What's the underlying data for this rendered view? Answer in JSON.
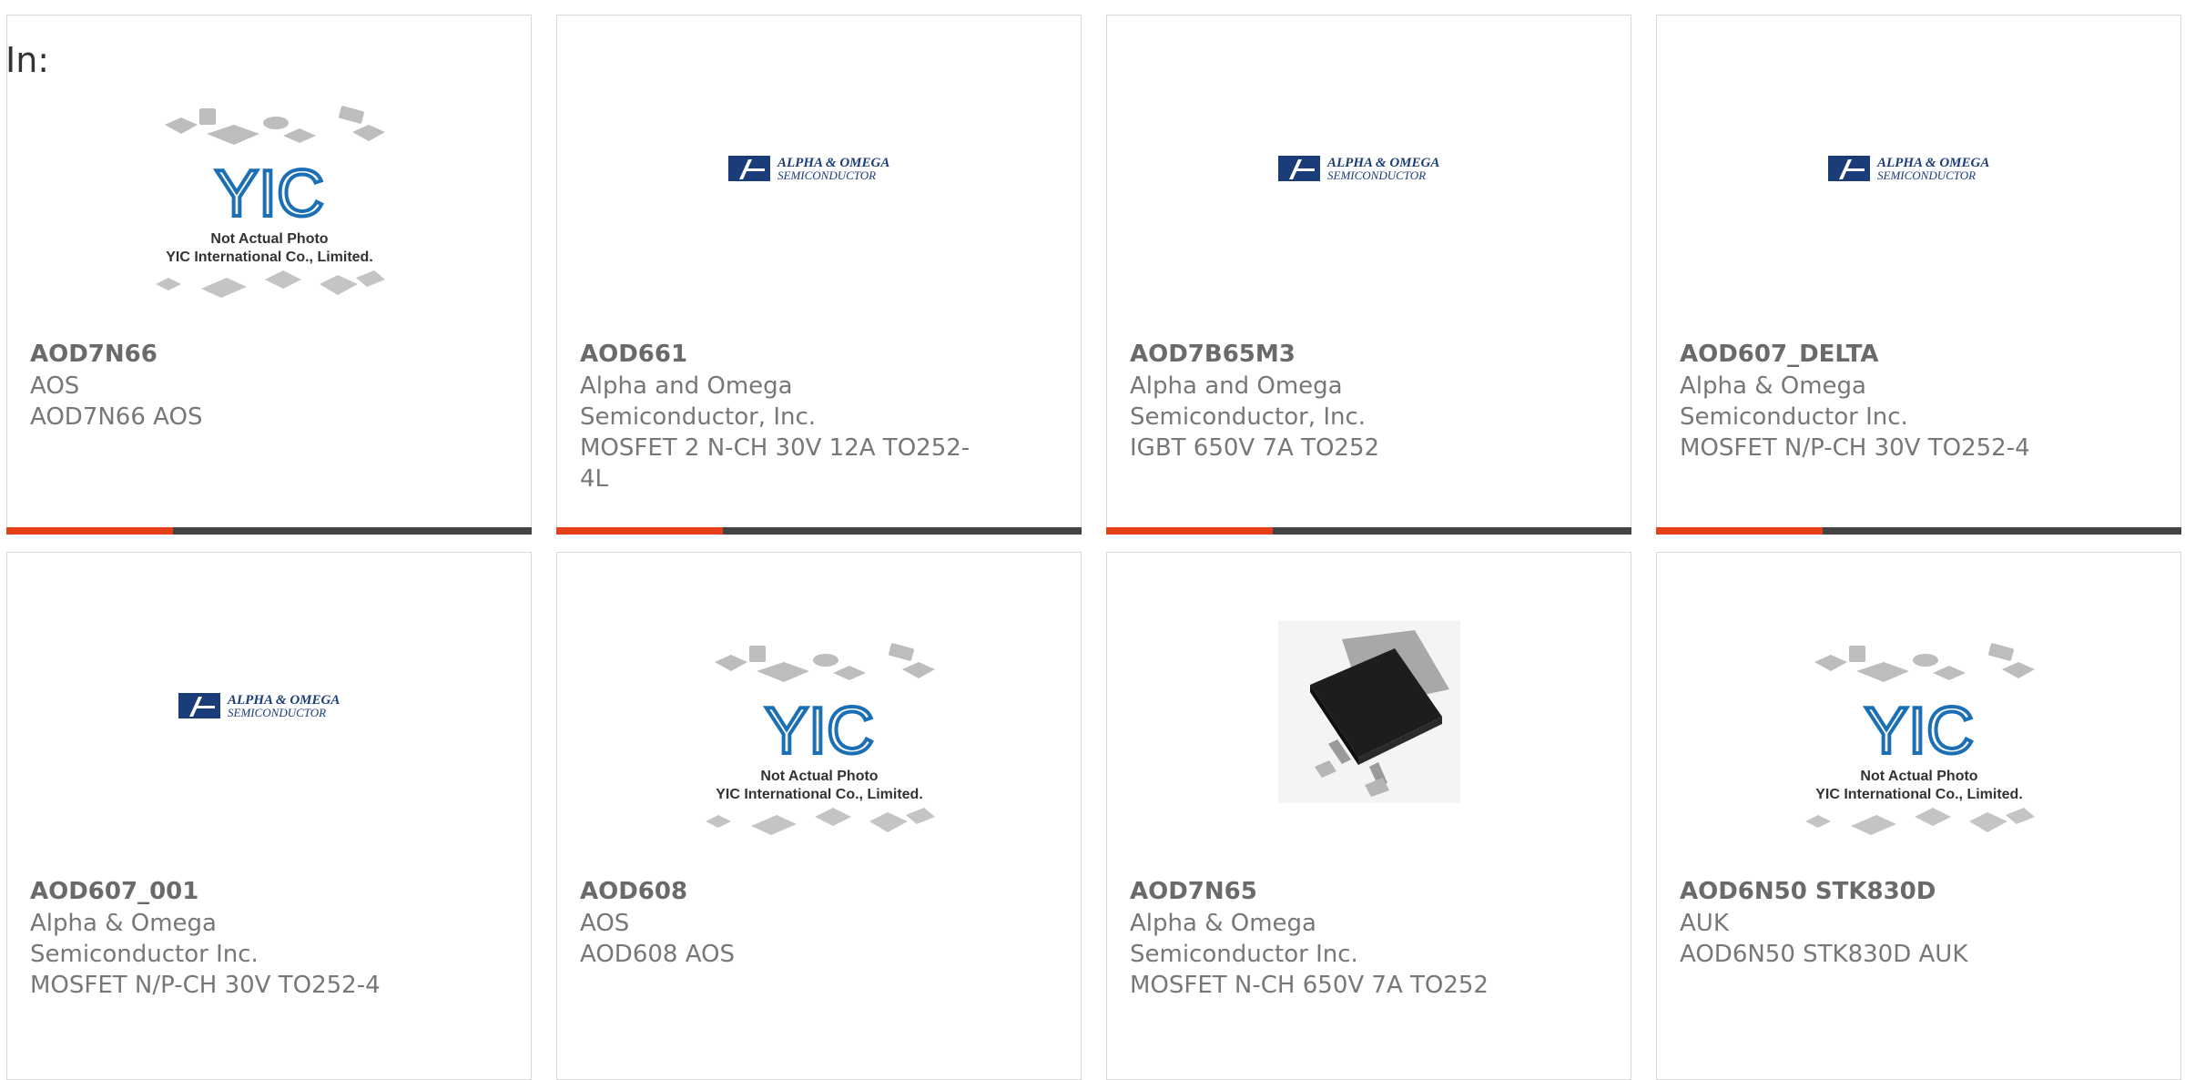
{
  "in_label": "In:",
  "colors": {
    "accent": "#e6401a",
    "bar": "#444444",
    "yic_blue": "#1b6fb5",
    "aos_blue": "#1a3c78"
  },
  "placeholder_text": {
    "line1": "Not Actual Photo",
    "line2": "YIC International Co., Limited."
  },
  "aos_logo": {
    "line1": "ALPHA & OMEGA",
    "line2": "SEMICONDUCTOR"
  },
  "products": [
    {
      "name": "AOD7N66",
      "manufacturer": "AOS",
      "description": "AOD7N66 AOS",
      "image": "yic-placeholder"
    },
    {
      "name": "AOD661",
      "manufacturer": "Alpha and Omega Semiconductor, Inc.",
      "description": "MOSFET 2 N-CH 30V 12A TO252-4L",
      "image": "aos-logo"
    },
    {
      "name": "AOD7B65M3",
      "manufacturer": "Alpha and Omega Semiconductor, Inc.",
      "description": "IGBT 650V 7A TO252",
      "image": "aos-logo"
    },
    {
      "name": "AOD607_DELTA",
      "manufacturer": "Alpha & Omega Semiconductor Inc.",
      "description": "MOSFET N/P-CH 30V TO252-4",
      "image": "aos-logo"
    },
    {
      "name": "AOD607_001",
      "manufacturer": "Alpha & Omega Semiconductor Inc.",
      "description": "MOSFET N/P-CH 30V TO252-4",
      "image": "aos-logo"
    },
    {
      "name": "AOD608",
      "manufacturer": "AOS",
      "description": "AOD608 AOS",
      "image": "yic-placeholder"
    },
    {
      "name": "AOD7N65",
      "manufacturer": "Alpha & Omega Semiconductor Inc.",
      "description": "MOSFET N-CH 650V 7A TO252",
      "image": "to252-package"
    },
    {
      "name": "AOD6N50 STK830D",
      "manufacturer": "AUK",
      "description": "AOD6N50 STK830D AUK",
      "image": "yic-placeholder"
    }
  ]
}
